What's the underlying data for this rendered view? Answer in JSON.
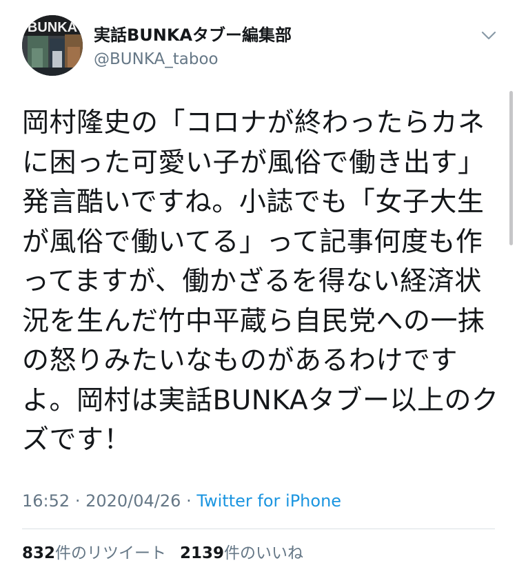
{
  "user": {
    "display_name": "実話BUNKAタブー編集部",
    "handle": "@BUNKA_taboo",
    "avatar_label": "BUNKA"
  },
  "tweet": {
    "lines": [
      "岡村隆史の「コロナが終わったらカネ",
      "に困った可愛い子が風俗で働き出す」",
      "発言酷いですね。小誌でも「女子大生",
      "が風俗で働いてる」って記事何度も作",
      "ってますが、働かざるを得ない経済状",
      "況を生んだ竹中平蔵ら自民党への一抹",
      "の怒りみたいなものがあるわけです",
      "よ。岡村は実話BUNKAタブー以上のク",
      "ズです！"
    ],
    "time": "16:52",
    "separator": "·",
    "date": "2020/04/26",
    "source": "Twitter for iPhone"
  },
  "stats": {
    "retweets_count": "832",
    "retweets_label": "件のリツイート",
    "likes_count": "2139",
    "likes_label": "件のいいね"
  },
  "icons": {
    "menu": "chevron-down-icon"
  },
  "colors": {
    "text": "#14171a",
    "secondary": "#657786",
    "link": "#1b95e0",
    "divider": "#d9dfe4"
  }
}
